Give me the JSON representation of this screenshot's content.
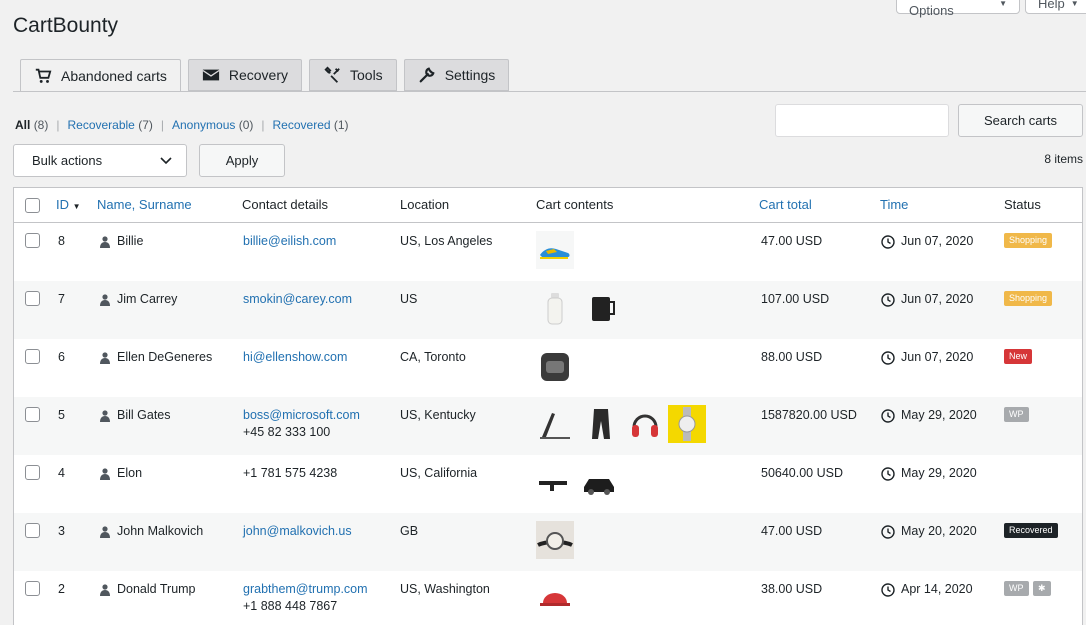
{
  "header": {
    "title": "CartBounty",
    "screen_options": "Screen Options",
    "help": "Help"
  },
  "tabs": [
    {
      "label": "Abandoned carts",
      "icon": "cart-icon",
      "active": true
    },
    {
      "label": "Recovery",
      "icon": "envelope-icon",
      "active": false
    },
    {
      "label": "Tools",
      "icon": "tools-icon",
      "active": false
    },
    {
      "label": "Settings",
      "icon": "wrench-icon",
      "active": false
    }
  ],
  "filters": [
    {
      "label": "All",
      "count": "(8)"
    },
    {
      "label": "Recoverable",
      "count": "(7)"
    },
    {
      "label": "Anonymous",
      "count": "(0)"
    },
    {
      "label": "Recovered",
      "count": "(1)"
    }
  ],
  "search": {
    "placeholder": "",
    "button": "Search carts"
  },
  "bulk": {
    "label": "Bulk actions",
    "apply": "Apply",
    "items": "8 items"
  },
  "columns": {
    "id": "ID",
    "name": "Name, Surname",
    "contact": "Contact details",
    "location": "Location",
    "cart": "Cart contents",
    "total": "Cart total",
    "time": "Time",
    "status": "Status"
  },
  "colors": {
    "shopping": "#f0b849",
    "new": "#d63638",
    "wp": "#a7aaad",
    "recovered": "#1d2327"
  },
  "rows": [
    {
      "id": "8",
      "name": "Billie",
      "email": "billie@eilish.com",
      "phone": "",
      "location": "US, Los Angeles",
      "products": [
        "sneaker"
      ],
      "total": "47.00 USD",
      "time": "Jun 07, 2020",
      "status": [
        "Shopping"
      ]
    },
    {
      "id": "7",
      "name": "Jim Carrey",
      "email": "smokin@carey.com",
      "phone": "",
      "location": "US",
      "products": [
        "bottle",
        "mug"
      ],
      "total": "107.00 USD",
      "time": "Jun 07, 2020",
      "status": [
        "Shopping"
      ]
    },
    {
      "id": "6",
      "name": "Ellen DeGeneres",
      "email": "hi@ellenshow.com",
      "phone": "",
      "location": "CA, Toronto",
      "products": [
        "camera"
      ],
      "total": "88.00 USD",
      "time": "Jun 07, 2020",
      "status": [
        "New"
      ]
    },
    {
      "id": "5",
      "name": "Bill Gates",
      "email": "boss@microsoft.com",
      "phone": "+45 82 333 100",
      "location": "US, Kentucky",
      "products": [
        "laptop",
        "pants",
        "headphones",
        "watch"
      ],
      "total": "1587820.00 USD",
      "time": "May 29, 2020",
      "status": [
        "WP"
      ]
    },
    {
      "id": "4",
      "name": "Elon",
      "email": "",
      "phone": "+1 781 575 4238",
      "location": "US, California",
      "products": [
        "flamethrower",
        "car"
      ],
      "total": "50640.00 USD",
      "time": "May 29, 2020",
      "status": []
    },
    {
      "id": "3",
      "name": "John Malkovich",
      "email": "john@malkovich.us",
      "phone": "",
      "location": "GB",
      "products": [
        "wristwatch"
      ],
      "total": "47.00 USD",
      "time": "May 20, 2020",
      "status": [
        "Recovered"
      ]
    },
    {
      "id": "2",
      "name": "Donald Trump",
      "email": "grabthem@trump.com",
      "phone": "+1 888 448 7867",
      "location": "US, Washington",
      "products": [
        "cap"
      ],
      "total": "38.00 USD",
      "time": "Apr 14, 2020",
      "status": [
        "WP",
        "flag"
      ]
    }
  ]
}
